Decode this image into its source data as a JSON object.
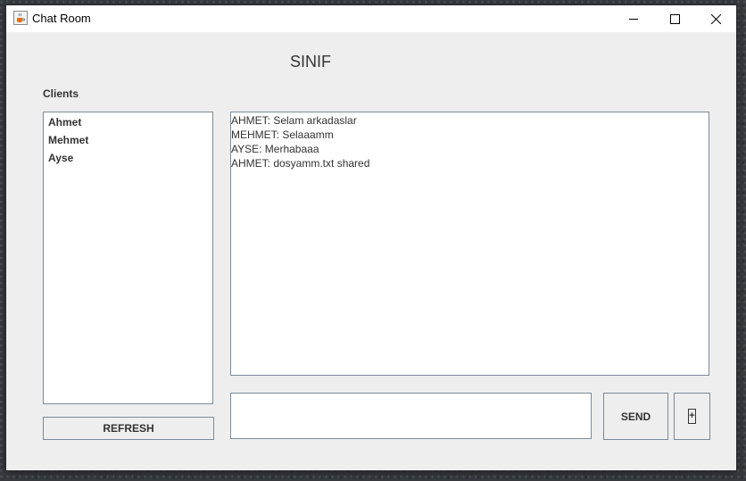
{
  "window": {
    "title": "Chat Room",
    "icon": "java-cup-icon",
    "controls": [
      "minimize-icon",
      "maximize-icon",
      "close-icon"
    ]
  },
  "room": {
    "title": "SINIF"
  },
  "clients": {
    "label": "Clients",
    "items": [
      "Ahmet",
      "Mehmet",
      "Ayse"
    ],
    "refresh_label": "REFRESH"
  },
  "chat": {
    "messages": [
      "AHMET: Selam arkadaslar",
      "MEHMET: Selaaamm",
      "AYSE: Merhabaaa",
      "AHMET: dosyamm.txt shared"
    ],
    "input_value": "",
    "send_label": "SEND",
    "attach_label": "+"
  }
}
